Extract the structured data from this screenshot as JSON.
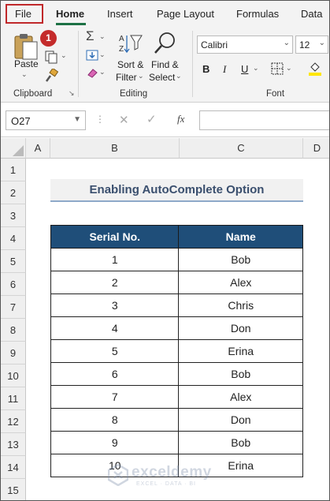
{
  "tabs": [
    {
      "label": "File"
    },
    {
      "label": "Home"
    },
    {
      "label": "Insert"
    },
    {
      "label": "Page Layout"
    },
    {
      "label": "Formulas"
    },
    {
      "label": "Data"
    }
  ],
  "step_badge": "1",
  "ribbon": {
    "clipboard": {
      "paste_label": "Paste",
      "group_label": "Clipboard"
    },
    "editing": {
      "sort_label": "Sort &",
      "filter_label": "Filter",
      "find_label": "Find &",
      "select_label": "Select",
      "group_label": "Editing"
    },
    "font": {
      "font_name": "Calibri",
      "font_size": "12",
      "bold": "B",
      "italic": "I",
      "underline": "U",
      "group_label": "Font"
    }
  },
  "formula_bar": {
    "name_box": "O27",
    "fx": "fx",
    "formula": ""
  },
  "columns": [
    "A",
    "B",
    "C",
    "D"
  ],
  "rows": [
    "1",
    "2",
    "3",
    "4",
    "5",
    "6",
    "7",
    "8",
    "9",
    "10",
    "11",
    "12",
    "13",
    "14",
    "15"
  ],
  "sheet": {
    "title": "Enabling AutoComplete Option",
    "headers": [
      "Serial No.",
      "Name"
    ],
    "records": [
      [
        "1",
        "Bob"
      ],
      [
        "2",
        "Alex"
      ],
      [
        "3",
        "Chris"
      ],
      [
        "4",
        "Don"
      ],
      [
        "5",
        "Erina"
      ],
      [
        "6",
        "Bob"
      ],
      [
        "7",
        "Alex"
      ],
      [
        "8",
        "Don"
      ],
      [
        "9",
        "Bob"
      ],
      [
        "10",
        "Erina"
      ]
    ]
  },
  "watermark": {
    "name": "exceldemy",
    "tagline": "EXCEL · DATA · BI"
  },
  "colors": {
    "accent_green": "#1e7145",
    "header_fill": "#1f4e79",
    "highlight_red": "#c0282a"
  }
}
